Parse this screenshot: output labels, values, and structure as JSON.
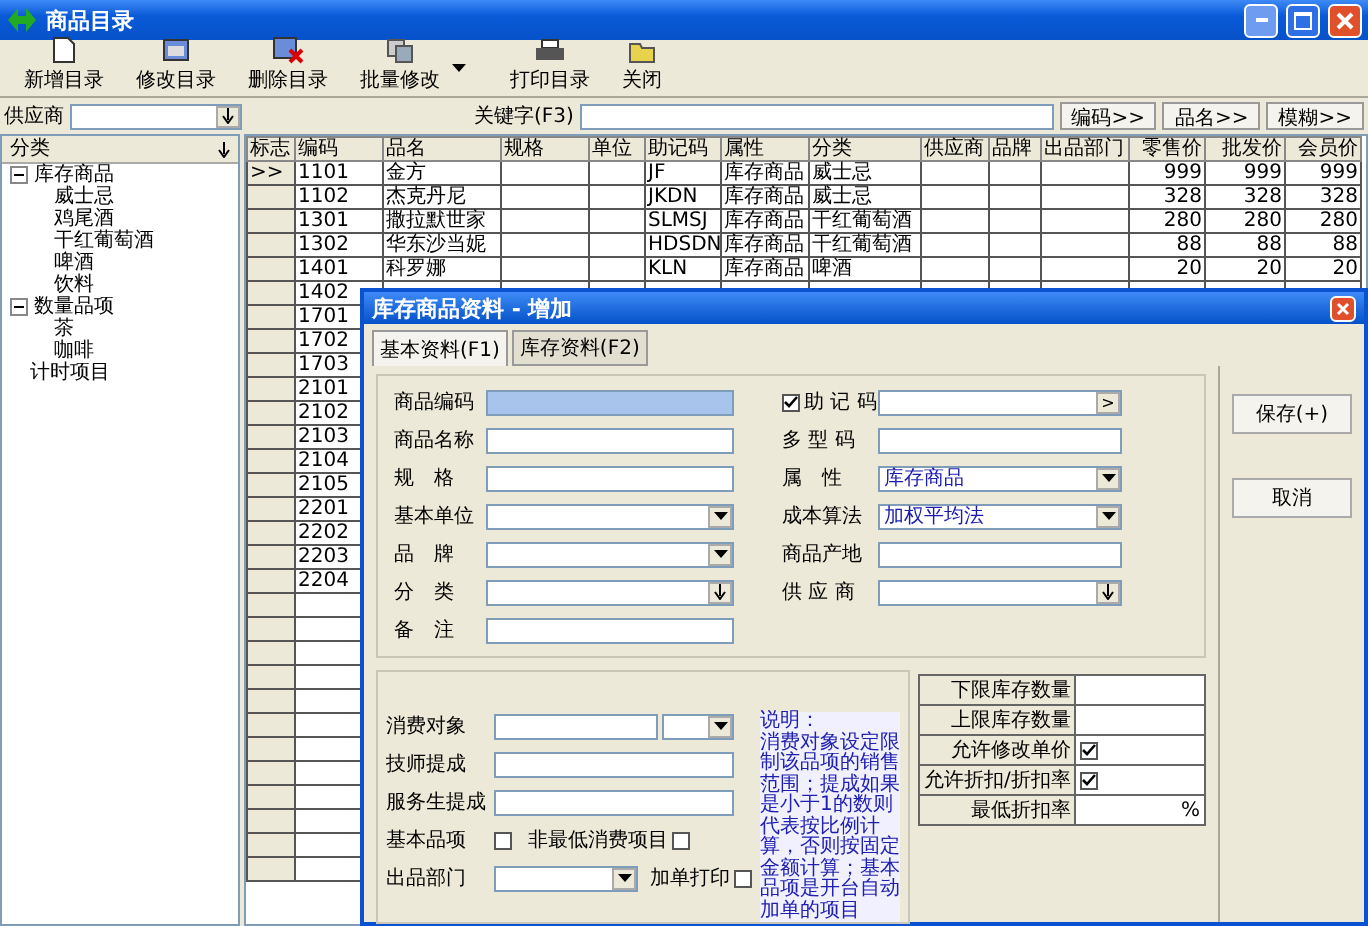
{
  "window": {
    "title": "商品目录"
  },
  "toolbar": [
    {
      "label": "新增目录",
      "dropdown": false
    },
    {
      "label": "修改目录",
      "dropdown": false
    },
    {
      "label": "删除目录",
      "dropdown": false
    },
    {
      "label": "批量修改",
      "dropdown": true
    },
    {
      "label": "打印目录",
      "dropdown": false
    },
    {
      "label": "关闭",
      "dropdown": false
    }
  ],
  "filter": {
    "supplier_label": "供应商",
    "keyword_label": "关键字(F3)",
    "buttons": [
      "编码>>",
      "品名>>",
      "模糊>>"
    ]
  },
  "tree": {
    "header": "分类",
    "items": [
      {
        "label": "库存商品",
        "expanded": true,
        "children": [
          {
            "label": "威士忌"
          },
          {
            "label": "鸡尾酒"
          },
          {
            "label": "干红葡萄酒"
          },
          {
            "label": "啤酒"
          },
          {
            "label": "饮料"
          }
        ]
      },
      {
        "label": "数量品项",
        "expanded": true,
        "children": [
          {
            "label": "茶"
          },
          {
            "label": "咖啡"
          }
        ]
      },
      {
        "label": "计时项目"
      }
    ]
  },
  "grid": {
    "columns": [
      {
        "label": "标志",
        "kind": "marker"
      },
      {
        "label": "编码",
        "kind": "text"
      },
      {
        "label": "品名",
        "kind": "text"
      },
      {
        "label": "规格",
        "kind": "text"
      },
      {
        "label": "单位",
        "kind": "text"
      },
      {
        "label": "助记码",
        "kind": "text"
      },
      {
        "label": "属性",
        "kind": "text"
      },
      {
        "label": "分类",
        "kind": "text"
      },
      {
        "label": "供应商",
        "kind": "text"
      },
      {
        "label": "品牌",
        "kind": "text"
      },
      {
        "label": "出品部门",
        "kind": "text"
      },
      {
        "label": "零售价",
        "kind": "number"
      },
      {
        "label": "批发价",
        "kind": "number"
      },
      {
        "label": "会员价",
        "kind": "number"
      }
    ],
    "rows": [
      {
        "cells": [
          ">>",
          "1101",
          "金方",
          "",
          "",
          "JF",
          "库存商品",
          "威士忌",
          "",
          "",
          "",
          "999",
          "999",
          "999"
        ]
      },
      {
        "cells": [
          "",
          "1102",
          "杰克丹尼",
          "",
          "",
          "JKDN",
          "库存商品",
          "威士忌",
          "",
          "",
          "",
          "328",
          "328",
          "328"
        ]
      },
      {
        "cells": [
          "",
          "1301",
          "撒拉默世家",
          "",
          "",
          "SLMSJ",
          "库存商品",
          "干红葡萄酒",
          "",
          "",
          "",
          "280",
          "280",
          "280"
        ]
      },
      {
        "cells": [
          "",
          "1302",
          "华东沙当妮",
          "",
          "",
          "HDSDN",
          "库存商品",
          "干红葡萄酒",
          "",
          "",
          "",
          "88",
          "88",
          "88"
        ]
      },
      {
        "cells": [
          "",
          "1401",
          "科罗娜",
          "",
          "",
          "KLN",
          "库存商品",
          "啤酒",
          "",
          "",
          "",
          "20",
          "20",
          "20"
        ]
      },
      {
        "cells": [
          "",
          "1402"
        ]
      },
      {
        "cells": [
          "",
          "1701"
        ]
      },
      {
        "cells": [
          "",
          "1702"
        ]
      },
      {
        "cells": [
          "",
          "1703"
        ]
      },
      {
        "cells": [
          "",
          "2101"
        ]
      },
      {
        "cells": [
          "",
          "2102"
        ]
      },
      {
        "cells": [
          "",
          "2103"
        ]
      },
      {
        "cells": [
          "",
          "2104"
        ]
      },
      {
        "cells": [
          "",
          "2105"
        ]
      },
      {
        "cells": [
          "",
          "2201"
        ]
      },
      {
        "cells": [
          "",
          "2202"
        ]
      },
      {
        "cells": [
          "",
          "2203"
        ]
      },
      {
        "cells": [
          "",
          "2204"
        ]
      }
    ]
  },
  "dialog": {
    "title": "库存商品资料 - 增加",
    "tabs": [
      {
        "label": "基本资料(F1)",
        "selected": true
      },
      {
        "label": "库存资料(F2)",
        "selected": false
      }
    ],
    "left_fields": [
      {
        "label": "商品编码",
        "kind": "text",
        "focused": true
      },
      {
        "label": "商品名称",
        "kind": "text",
        "focused": false
      },
      {
        "label": "规　格",
        "kind": "text",
        "focused": false
      },
      {
        "label": "基本单位",
        "kind": "select",
        "focused": false
      },
      {
        "label": "品　牌",
        "kind": "select",
        "focused": false
      },
      {
        "label": "分　类",
        "kind": "lookup",
        "focused": false
      },
      {
        "label": "备　注",
        "kind": "text",
        "focused": false
      }
    ],
    "right_fields": [
      {
        "label": "助 记 码",
        "kind": "check_button",
        "checked": true,
        "button": ">"
      },
      {
        "label": "多 型 码",
        "kind": "text"
      },
      {
        "label": "属　性",
        "kind": "select",
        "value": "库存商品"
      },
      {
        "label": "成本算法",
        "kind": "select",
        "value": "加权平均法"
      },
      {
        "label": "商品产地",
        "kind": "text"
      },
      {
        "label": "供 应 商",
        "kind": "lookup"
      }
    ],
    "buttons": [
      "保存(+)",
      "取消"
    ],
    "lower": {
      "fields": [
        {
          "label": "消费对象",
          "kind": "combo"
        },
        {
          "label": "技师提成",
          "kind": "text"
        },
        {
          "label": "服务生提成",
          "kind": "text"
        }
      ],
      "basic_item": {
        "label": "基本品项",
        "checked": false
      },
      "non_min": {
        "label": "非最低消费项目",
        "checked": false
      },
      "department": {
        "label": "出品部门"
      },
      "print": {
        "label": "加单打印",
        "checked": false
      },
      "note_title": "说明：",
      "note": "消费对象设定限制该品项的销售范围；提成如果是小于1的数则代表按比例计算，否则按固定金额计算；基本品项是开台自动加单的项目"
    },
    "limits": [
      {
        "label": "下限库存数量",
        "kind": "text"
      },
      {
        "label": "上限库存数量",
        "kind": "text"
      },
      {
        "label": "允许修改单价",
        "kind": "check",
        "checked": true
      },
      {
        "label": "允许折扣/折扣率",
        "kind": "check",
        "checked": true
      },
      {
        "label": "最低折扣率",
        "kind": "percent",
        "suffix": "%"
      }
    ]
  }
}
